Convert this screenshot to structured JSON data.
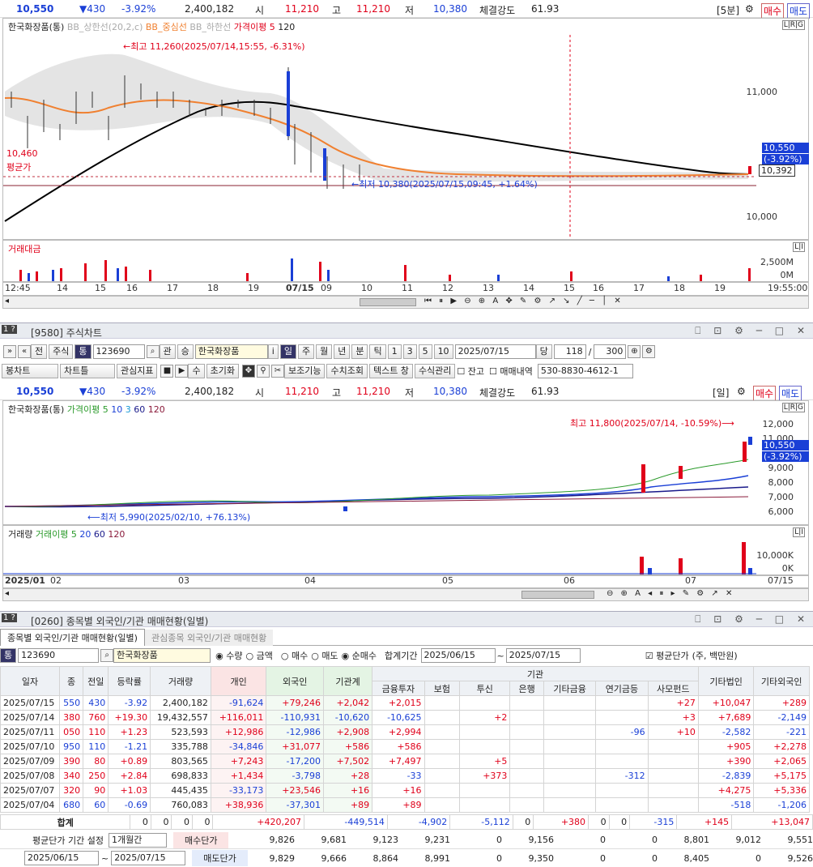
{
  "top_quote": {
    "price": "10,550",
    "change": "▼430",
    "pct": "-3.92%",
    "volume": "2,400,182",
    "open_lbl": "시",
    "open": "11,210",
    "high_lbl": "고",
    "high": "11,210",
    "low_lbl": "저",
    "low": "10,380",
    "str_lbl": "체결강도",
    "str": "61.93",
    "period": "[5분]",
    "buy": "매수",
    "sell": "매도"
  },
  "top_chart": {
    "legend": [
      "한국화장품(통)",
      "BB_상한선(20,2,c)",
      "BB_중심선",
      "BB_하한선",
      "가격이평 5",
      "120"
    ],
    "high_note": "←최고 11,260(2025/07/14,15:55, -6.31%)",
    "low_note": "←최저 10,380(2025/07/15,09:45, +1.64%)",
    "y_labels": [
      "11,000",
      "10,000"
    ],
    "left_label": "10,460",
    "avg_label": "평균가",
    "price_tag": "10,550",
    "price_tag2": "(-3.92%)",
    "avg_tag": "10,392",
    "vol_legend": "거래대금",
    "vol_labels": [
      "2,500M",
      "0M"
    ],
    "x_labels": [
      "12:45",
      "14",
      "15",
      "16",
      "17",
      "18",
      "19",
      "07/15",
      "09",
      "10",
      "11",
      "12",
      "13",
      "14",
      "15",
      "16",
      "17",
      "18",
      "19"
    ],
    "time": "19:55:00",
    "lrg": "L|R|G",
    "li": "L|I"
  },
  "win2": {
    "title": "[9580] 주식차트",
    "code": "123690",
    "name": "한국화장품",
    "date": "2025/07/15",
    "day_btn": "당",
    "count1": "118",
    "count2": "300",
    "tb1": [
      "전",
      "주식",
      "통"
    ],
    "tb1b": [
      "관",
      "승"
    ],
    "periods": [
      "일",
      "주",
      "월",
      "년",
      "분",
      "틱",
      "1",
      "3",
      "5",
      "10"
    ],
    "tb2": [
      "봉차트",
      "차트틀",
      "관심지표",
      "수",
      "초기화",
      "보조기능",
      "수치조회",
      "텍스트 창",
      "수식관리",
      "잔고",
      "매매내역"
    ],
    "account": "530-8830-4612-1",
    "quote": {
      "price": "10,550",
      "change": "▼430",
      "pct": "-3.92%",
      "volume": "2,400,182",
      "open_lbl": "시",
      "open": "11,210",
      "high_lbl": "고",
      "high": "11,210",
      "low_lbl": "저",
      "low": "10,380",
      "str_lbl": "체결강도",
      "str": "61.93",
      "period": "[일]",
      "buy": "매수",
      "sell": "매도"
    },
    "legend": [
      "한국화장품(통)",
      "가격이평 5",
      "10",
      "3",
      "60",
      "120"
    ],
    "high_note": "최고 11,800(2025/07/14, -10.59%)⟶",
    "low_note": "⟵최저 5,990(2025/02/10, +76.13%)",
    "y_labels": [
      "12,000",
      "11,000",
      "9,000",
      "8,000",
      "7,000",
      "6,000"
    ],
    "price_tag": "10,550",
    "price_tag2": "(-3.92%)",
    "vol_legend": [
      "거래량",
      "거래이평 5",
      "20",
      "60",
      "120"
    ],
    "vol_labels": [
      "10,000K",
      "0K"
    ],
    "x_labels": [
      "2025/01",
      "02",
      "03",
      "04",
      "05",
      "06",
      "07"
    ],
    "x_end": "07/15"
  },
  "win3": {
    "title": "[0260] 종목별 외국인/기관 매매현황(일별)",
    "tabs": [
      "종목별 외국인/기관 매매현황(일별)",
      "관심종목 외국인/기관 매매현황"
    ],
    "code": "123690",
    "name": "한국화장품",
    "radios1": [
      "수량",
      "금액"
    ],
    "radios2": [
      "매수",
      "매도",
      "순매수"
    ],
    "period_lbl": "합계기간",
    "date_from": "2025/06/15",
    "date_to": "2025/07/15",
    "avg_chk": "평균단가",
    "unit": "(주, 백만원)",
    "head1": [
      "일자",
      "종",
      "전일",
      "등락률",
      "거래량",
      "개인",
      "외국인",
      "기관계",
      "기관",
      "기타법인",
      "기타외국인"
    ],
    "head2": [
      "금융투자",
      "보험",
      "투신",
      "은행",
      "기타금융",
      "연기금등",
      "사모펀드"
    ],
    "rows": [
      [
        "2025/07/15",
        "550",
        "430",
        "-3.92",
        "2,400,182",
        "-91,624",
        "+79,246",
        "+2,042",
        "+2,015",
        "",
        "",
        "",
        "",
        "",
        "+27",
        "+10,047",
        "+289"
      ],
      [
        "2025/07/14",
        "380",
        "760",
        "+19.30",
        "19,432,557",
        "+116,011",
        "-110,931",
        "-10,620",
        "-10,625",
        "",
        "+2",
        "",
        "",
        "",
        "+3",
        "+7,689",
        "-2,149"
      ],
      [
        "2025/07/11",
        "050",
        "110",
        "+1.23",
        "523,593",
        "+12,986",
        "-12,986",
        "+2,908",
        "+2,994",
        "",
        "",
        "",
        "",
        "-96",
        "+10",
        "-2,582",
        "-221"
      ],
      [
        "2025/07/10",
        "950",
        "110",
        "-1.21",
        "335,788",
        "-34,846",
        "+31,077",
        "+586",
        "+586",
        "",
        "",
        "",
        "",
        "",
        "",
        "+905",
        "+2,278"
      ],
      [
        "2025/07/09",
        "390",
        "80",
        "+0.89",
        "803,565",
        "+7,243",
        "-17,200",
        "+7,502",
        "+7,497",
        "",
        "+5",
        "",
        "",
        "",
        "",
        "+390",
        "+2,065"
      ],
      [
        "2025/07/08",
        "340",
        "250",
        "+2.84",
        "698,833",
        "+1,434",
        "-3,798",
        "+28",
        "-33",
        "",
        "+373",
        "",
        "",
        "-312",
        "",
        "-2,839",
        "+5,175"
      ],
      [
        "2025/07/07",
        "320",
        "90",
        "+1.03",
        "445,435",
        "-33,173",
        "+23,546",
        "+16",
        "+16",
        "",
        "",
        "",
        "",
        "",
        "",
        "+4,275",
        "+5,336"
      ],
      [
        "2025/07/04",
        "680",
        "60",
        "-0.69",
        "760,083",
        "+38,936",
        "-37,301",
        "+89",
        "+89",
        "",
        "",
        "",
        "",
        "",
        "",
        "-518",
        "-1,206"
      ]
    ],
    "sum": [
      "합계",
      "0",
      "0",
      "0",
      "0",
      "+420,207",
      "-449,514",
      "-4,902",
      "-5,112",
      "0",
      "+380",
      "0",
      "0",
      "-315",
      "+145",
      "+13,047"
    ],
    "avg_lbl": "평균단가 기간 설정",
    "avg_sel": "1개월간",
    "buy_lbl": "매수단가",
    "buy": [
      "9,826",
      "9,681",
      "9,123",
      "9,231",
      "0",
      "9,156",
      "0",
      "0",
      "8,801",
      "9,012",
      "9,551"
    ],
    "sell_lbl": "매도단가",
    "sell": [
      "9,829",
      "9,666",
      "8,864",
      "8,991",
      "0",
      "9,350",
      "0",
      "0",
      "8,405",
      "0",
      "9,526"
    ],
    "d1": "2025/06/15",
    "d2": "2025/07/15"
  }
}
